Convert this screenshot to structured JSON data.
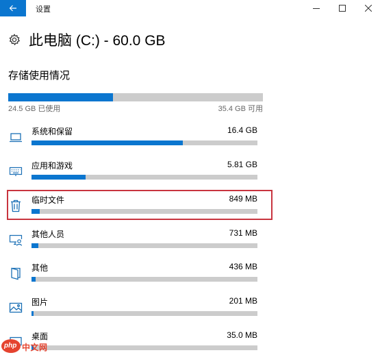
{
  "window": {
    "title": "设置"
  },
  "header": {
    "title": "此电脑 (C:) - 60.0 GB"
  },
  "storage": {
    "section_title": "存储使用情况",
    "used_label": "24.5 GB 已使用",
    "free_label": "35.4 GB 可用",
    "used_fraction": 0.41,
    "categories": [
      {
        "name": "系统和保留",
        "size": "16.4 GB",
        "fraction": 0.67,
        "icon": "laptop-icon"
      },
      {
        "name": "应用和游戏",
        "size": "5.81 GB",
        "fraction": 0.24,
        "icon": "keyboard-icon"
      },
      {
        "name": "临时文件",
        "size": "849 MB",
        "fraction": 0.035,
        "icon": "trash-icon",
        "highlighted": true
      },
      {
        "name": "其他人员",
        "size": "731 MB",
        "fraction": 0.03,
        "icon": "user-monitor-icon"
      },
      {
        "name": "其他",
        "size": "436 MB",
        "fraction": 0.018,
        "icon": "document-icon"
      },
      {
        "name": "图片",
        "size": "201 MB",
        "fraction": 0.008,
        "icon": "picture-icon"
      },
      {
        "name": "桌面",
        "size": "35.0 MB",
        "fraction": 0.002,
        "icon": "desktop-icon"
      }
    ]
  },
  "watermark": {
    "logo": "php",
    "text": "中文网"
  },
  "colors": {
    "accent": "#0b76cf",
    "bar_track": "#cccccc",
    "highlight": "#c8343e"
  }
}
